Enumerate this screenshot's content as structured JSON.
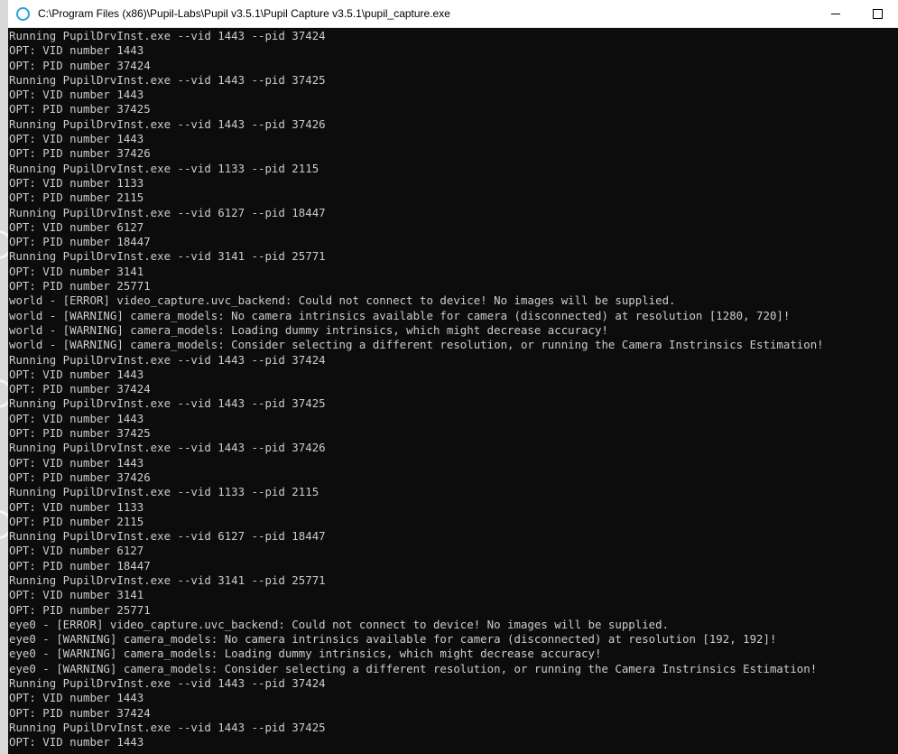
{
  "window": {
    "title": "C:\\Program Files (x86)\\Pupil-Labs\\Pupil v3.5.1\\Pupil Capture v3.5.1\\pupil_capture.exe",
    "app_icon": "circle-icon",
    "minimize_icon": "minimize-icon",
    "maximize_icon": "maximize-icon"
  },
  "console": {
    "lines": [
      "Running PupilDrvInst.exe --vid 1443 --pid 37424",
      "OPT: VID number 1443",
      "OPT: PID number 37424",
      "Running PupilDrvInst.exe --vid 1443 --pid 37425",
      "OPT: VID number 1443",
      "OPT: PID number 37425",
      "Running PupilDrvInst.exe --vid 1443 --pid 37426",
      "OPT: VID number 1443",
      "OPT: PID number 37426",
      "Running PupilDrvInst.exe --vid 1133 --pid 2115",
      "OPT: VID number 1133",
      "OPT: PID number 2115",
      "Running PupilDrvInst.exe --vid 6127 --pid 18447",
      "OPT: VID number 6127",
      "OPT: PID number 18447",
      "Running PupilDrvInst.exe --vid 3141 --pid 25771",
      "OPT: VID number 3141",
      "OPT: PID number 25771",
      "world - [ERROR] video_capture.uvc_backend: Could not connect to device! No images will be supplied.",
      "world - [WARNING] camera_models: No camera intrinsics available for camera (disconnected) at resolution [1280, 720]!",
      "world - [WARNING] camera_models: Loading dummy intrinsics, which might decrease accuracy!",
      "world - [WARNING] camera_models: Consider selecting a different resolution, or running the Camera Instrinsics Estimation!",
      "Running PupilDrvInst.exe --vid 1443 --pid 37424",
      "OPT: VID number 1443",
      "OPT: PID number 37424",
      "Running PupilDrvInst.exe --vid 1443 --pid 37425",
      "OPT: VID number 1443",
      "OPT: PID number 37425",
      "Running PupilDrvInst.exe --vid 1443 --pid 37426",
      "OPT: VID number 1443",
      "OPT: PID number 37426",
      "Running PupilDrvInst.exe --vid 1133 --pid 2115",
      "OPT: VID number 1133",
      "OPT: PID number 2115",
      "Running PupilDrvInst.exe --vid 6127 --pid 18447",
      "OPT: VID number 6127",
      "OPT: PID number 18447",
      "Running PupilDrvInst.exe --vid 3141 --pid 25771",
      "OPT: VID number 3141",
      "OPT: PID number 25771",
      "eye0 - [ERROR] video_capture.uvc_backend: Could not connect to device! No images will be supplied.",
      "eye0 - [WARNING] camera_models: No camera intrinsics available for camera (disconnected) at resolution [192, 192]!",
      "eye0 - [WARNING] camera_models: Loading dummy intrinsics, which might decrease accuracy!",
      "eye0 - [WARNING] camera_models: Consider selecting a different resolution, or running the Camera Instrinsics Estimation!",
      "Running PupilDrvInst.exe --vid 1443 --pid 37424",
      "OPT: VID number 1443",
      "OPT: PID number 37424",
      "Running PupilDrvInst.exe --vid 1443 --pid 37425",
      "OPT: VID number 1443"
    ]
  },
  "colors": {
    "console_background": "#0c0c0c",
    "console_text": "#cccccc",
    "titlebar_background": "#ffffff",
    "app_icon": "#2da1d3"
  }
}
